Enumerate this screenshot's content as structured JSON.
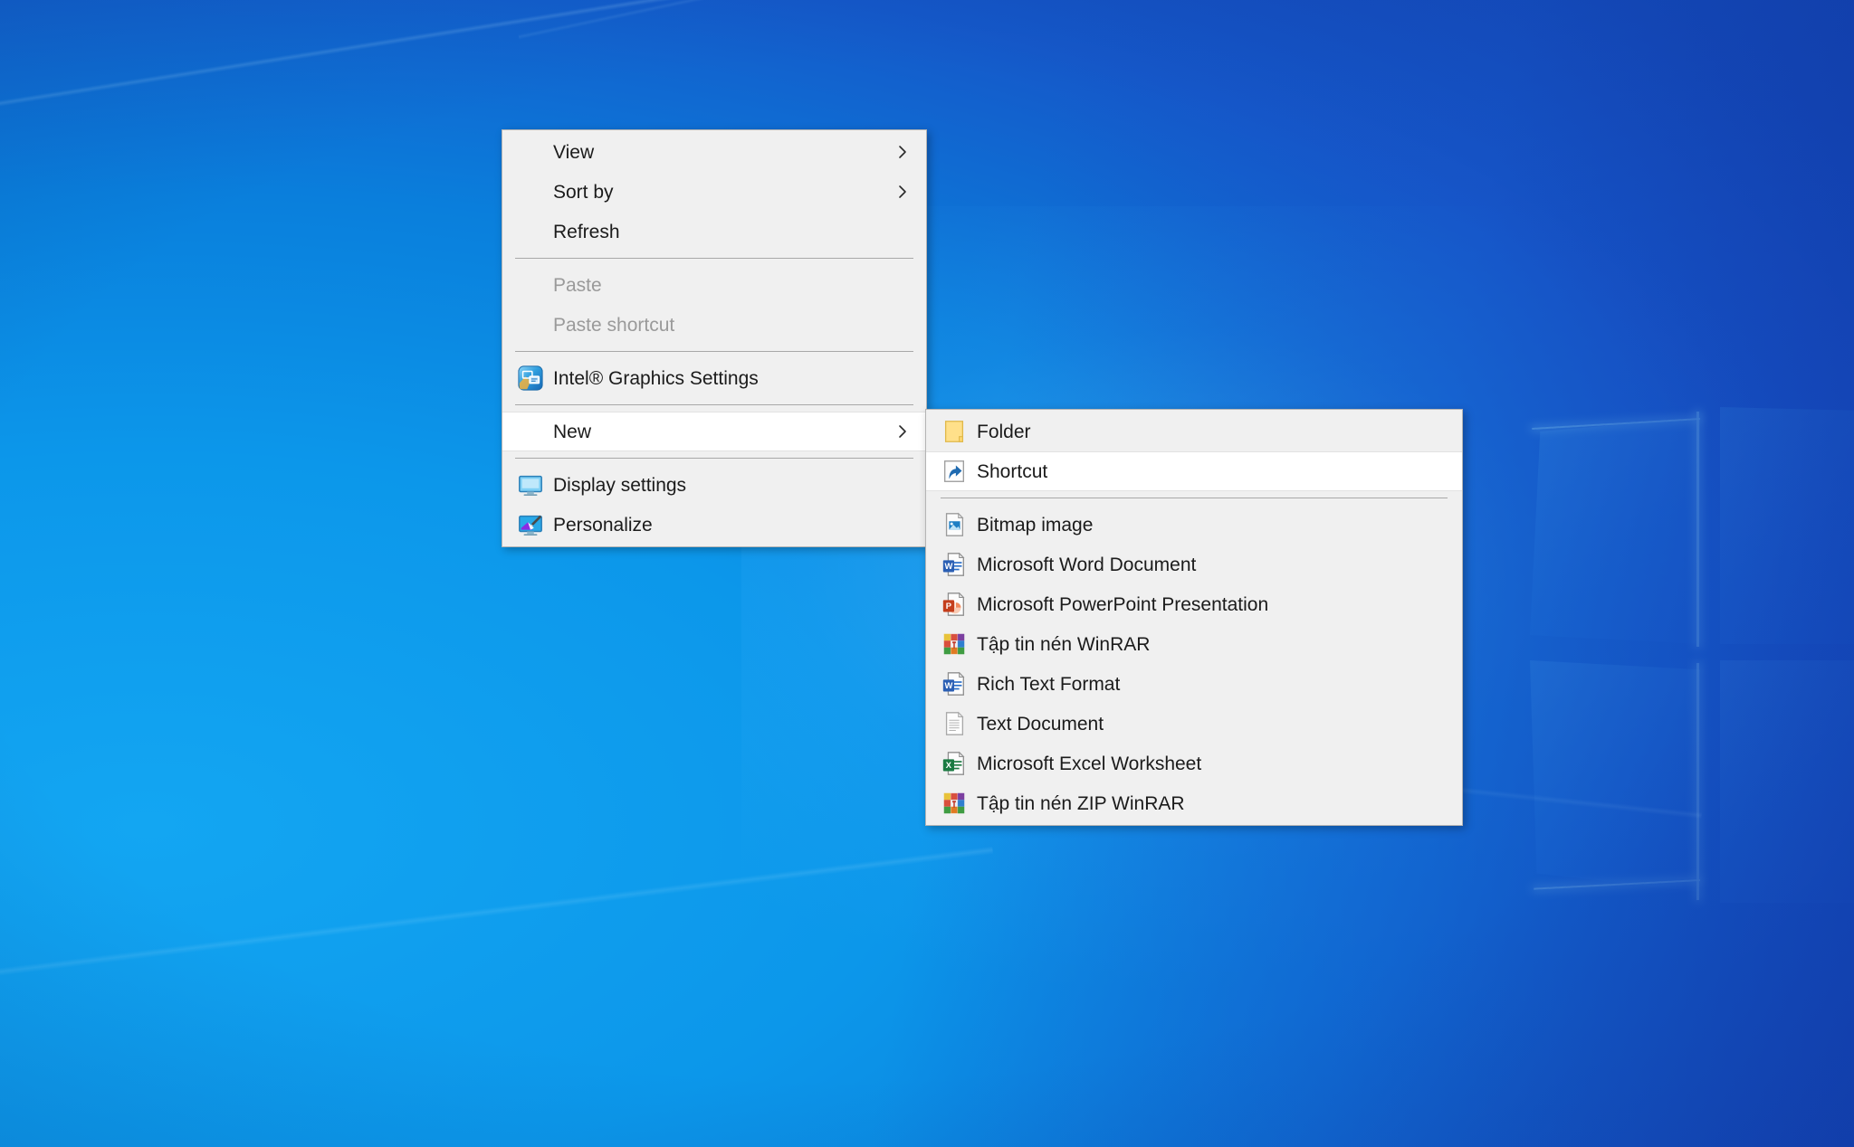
{
  "desktop": {
    "wallpaper_name": "windows-10-hero-wallpaper",
    "colors": {
      "sky_light": "#13a6f2",
      "sky_mid": "#0a7fdc",
      "sky_deep": "#1446b8",
      "pane_glow": "#8ceaff"
    }
  },
  "context_menu": {
    "name": "desktop-context-menu",
    "background": "#f0f0f0",
    "border": "#b4b4b4",
    "items": [
      {
        "label": "View",
        "icon": "none",
        "submenu": true,
        "disabled": false,
        "highlighted": false
      },
      {
        "label": "Sort by",
        "icon": "none",
        "submenu": true,
        "disabled": false,
        "highlighted": false
      },
      {
        "label": "Refresh",
        "icon": "none",
        "submenu": false,
        "disabled": false,
        "highlighted": false
      },
      {
        "separator": true
      },
      {
        "label": "Paste",
        "icon": "none",
        "submenu": false,
        "disabled": true,
        "highlighted": false
      },
      {
        "label": "Paste shortcut",
        "icon": "none",
        "submenu": false,
        "disabled": true,
        "highlighted": false
      },
      {
        "separator": true
      },
      {
        "label": "Intel® Graphics Settings",
        "icon": "intel-graphics-icon",
        "submenu": false,
        "disabled": false,
        "highlighted": false
      },
      {
        "separator": true
      },
      {
        "label": "New",
        "icon": "none",
        "submenu": true,
        "disabled": false,
        "highlighted": true
      },
      {
        "separator": true
      },
      {
        "label": "Display settings",
        "icon": "display-monitor-icon",
        "submenu": false,
        "disabled": false,
        "highlighted": false
      },
      {
        "label": "Personalize",
        "icon": "personalize-brush-icon",
        "submenu": false,
        "disabled": false,
        "highlighted": false
      }
    ]
  },
  "new_submenu": {
    "name": "new-submenu",
    "items": [
      {
        "label": "Folder",
        "icon": "folder-icon",
        "highlighted": false
      },
      {
        "label": "Shortcut",
        "icon": "shortcut-icon",
        "highlighted": true
      },
      {
        "separator": true
      },
      {
        "label": "Bitmap image",
        "icon": "bitmap-image-icon",
        "highlighted": false
      },
      {
        "label": "Microsoft Word Document",
        "icon": "word-icon",
        "highlighted": false
      },
      {
        "label": "Microsoft PowerPoint Presentation",
        "icon": "powerpoint-icon",
        "highlighted": false
      },
      {
        "label": "Tập tin nén WinRAR",
        "icon": "winrar-icon",
        "highlighted": false
      },
      {
        "label": "Rich Text Format",
        "icon": "word-icon",
        "highlighted": false
      },
      {
        "label": "Text Document",
        "icon": "text-document-icon",
        "highlighted": false
      },
      {
        "label": "Microsoft Excel Worksheet",
        "icon": "excel-icon",
        "highlighted": false
      },
      {
        "label": "Tập tin nén ZIP WinRAR",
        "icon": "winrar-icon",
        "highlighted": false
      }
    ]
  }
}
